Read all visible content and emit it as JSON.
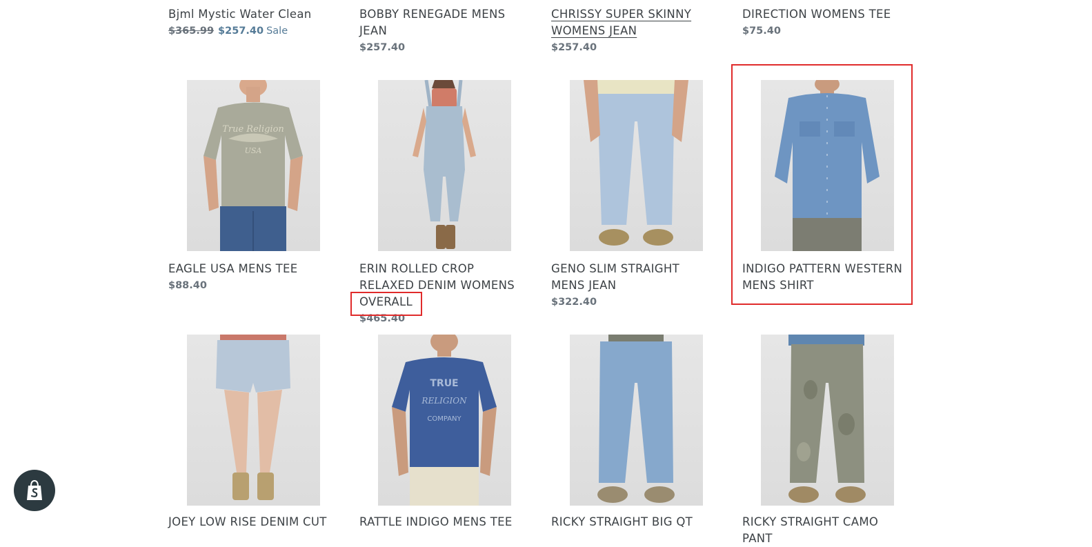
{
  "products": [
    {
      "title": "Bjml Mystic Water Clean",
      "price": "$257.40",
      "compare_price": "$365.99",
      "sale_label": "Sale"
    },
    {
      "title": "BOBBY RENEGADE MENS JEAN",
      "price": "$257.40"
    },
    {
      "title": "CHRISSY SUPER SKINNY WOMENS JEAN",
      "price": "$257.40"
    },
    {
      "title": "DIRECTION WOMENS TEE",
      "price": "$75.40"
    },
    {
      "title": "EAGLE USA MENS TEE",
      "price": "$88.40"
    },
    {
      "title": "ERIN ROLLED CROP RELAXED DENIM WOMENS OVERALL",
      "price": "$465.40"
    },
    {
      "title": "GENO SLIM STRAIGHT MENS JEAN",
      "price": "$322.40"
    },
    {
      "title": "INDIGO PATTERN WESTERN MENS SHIRT"
    },
    {
      "title": "JOEY LOW RISE DENIM CUT"
    },
    {
      "title": "RATTLE INDIGO MENS TEE"
    },
    {
      "title": "RICKY STRAIGHT BIG QT"
    },
    {
      "title": "RICKY STRAIGHT CAMO PANT"
    }
  ],
  "product_images": {
    "eagle": {
      "tee_text_1": "True Religion",
      "tee_text_2": "USA"
    },
    "rattle": {
      "tee_text_1": "TRUE",
      "tee_text_2": "RELIGION",
      "tee_text_3": "COMPANY"
    }
  },
  "shopify_badge": {
    "icon": "shopify-bag-icon",
    "color": "#2c3a40"
  },
  "colors": {
    "highlight": "#e02b2b",
    "sale": "#557b97",
    "text": "#3d4246"
  }
}
